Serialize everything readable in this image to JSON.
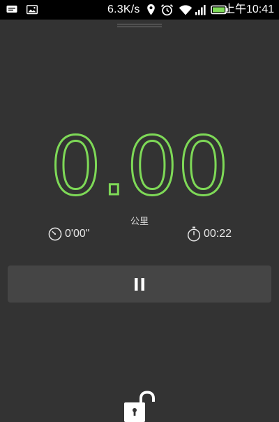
{
  "status_bar": {
    "network_speed": "6.3K/s",
    "time": "上午10:41",
    "icons": [
      "notification-icon",
      "gallery-notification-icon",
      "location-icon",
      "alarm-icon",
      "wifi-icon",
      "signal-icon",
      "battery-icon"
    ]
  },
  "workout": {
    "distance": "0.00",
    "distance_unit": "公里",
    "pace": "0'00\"",
    "elapsed": "00:22",
    "accent_color": "#7ed957"
  },
  "controls": {
    "pause_icon": "pause-icon",
    "unlock_icon": "unlock-icon"
  }
}
